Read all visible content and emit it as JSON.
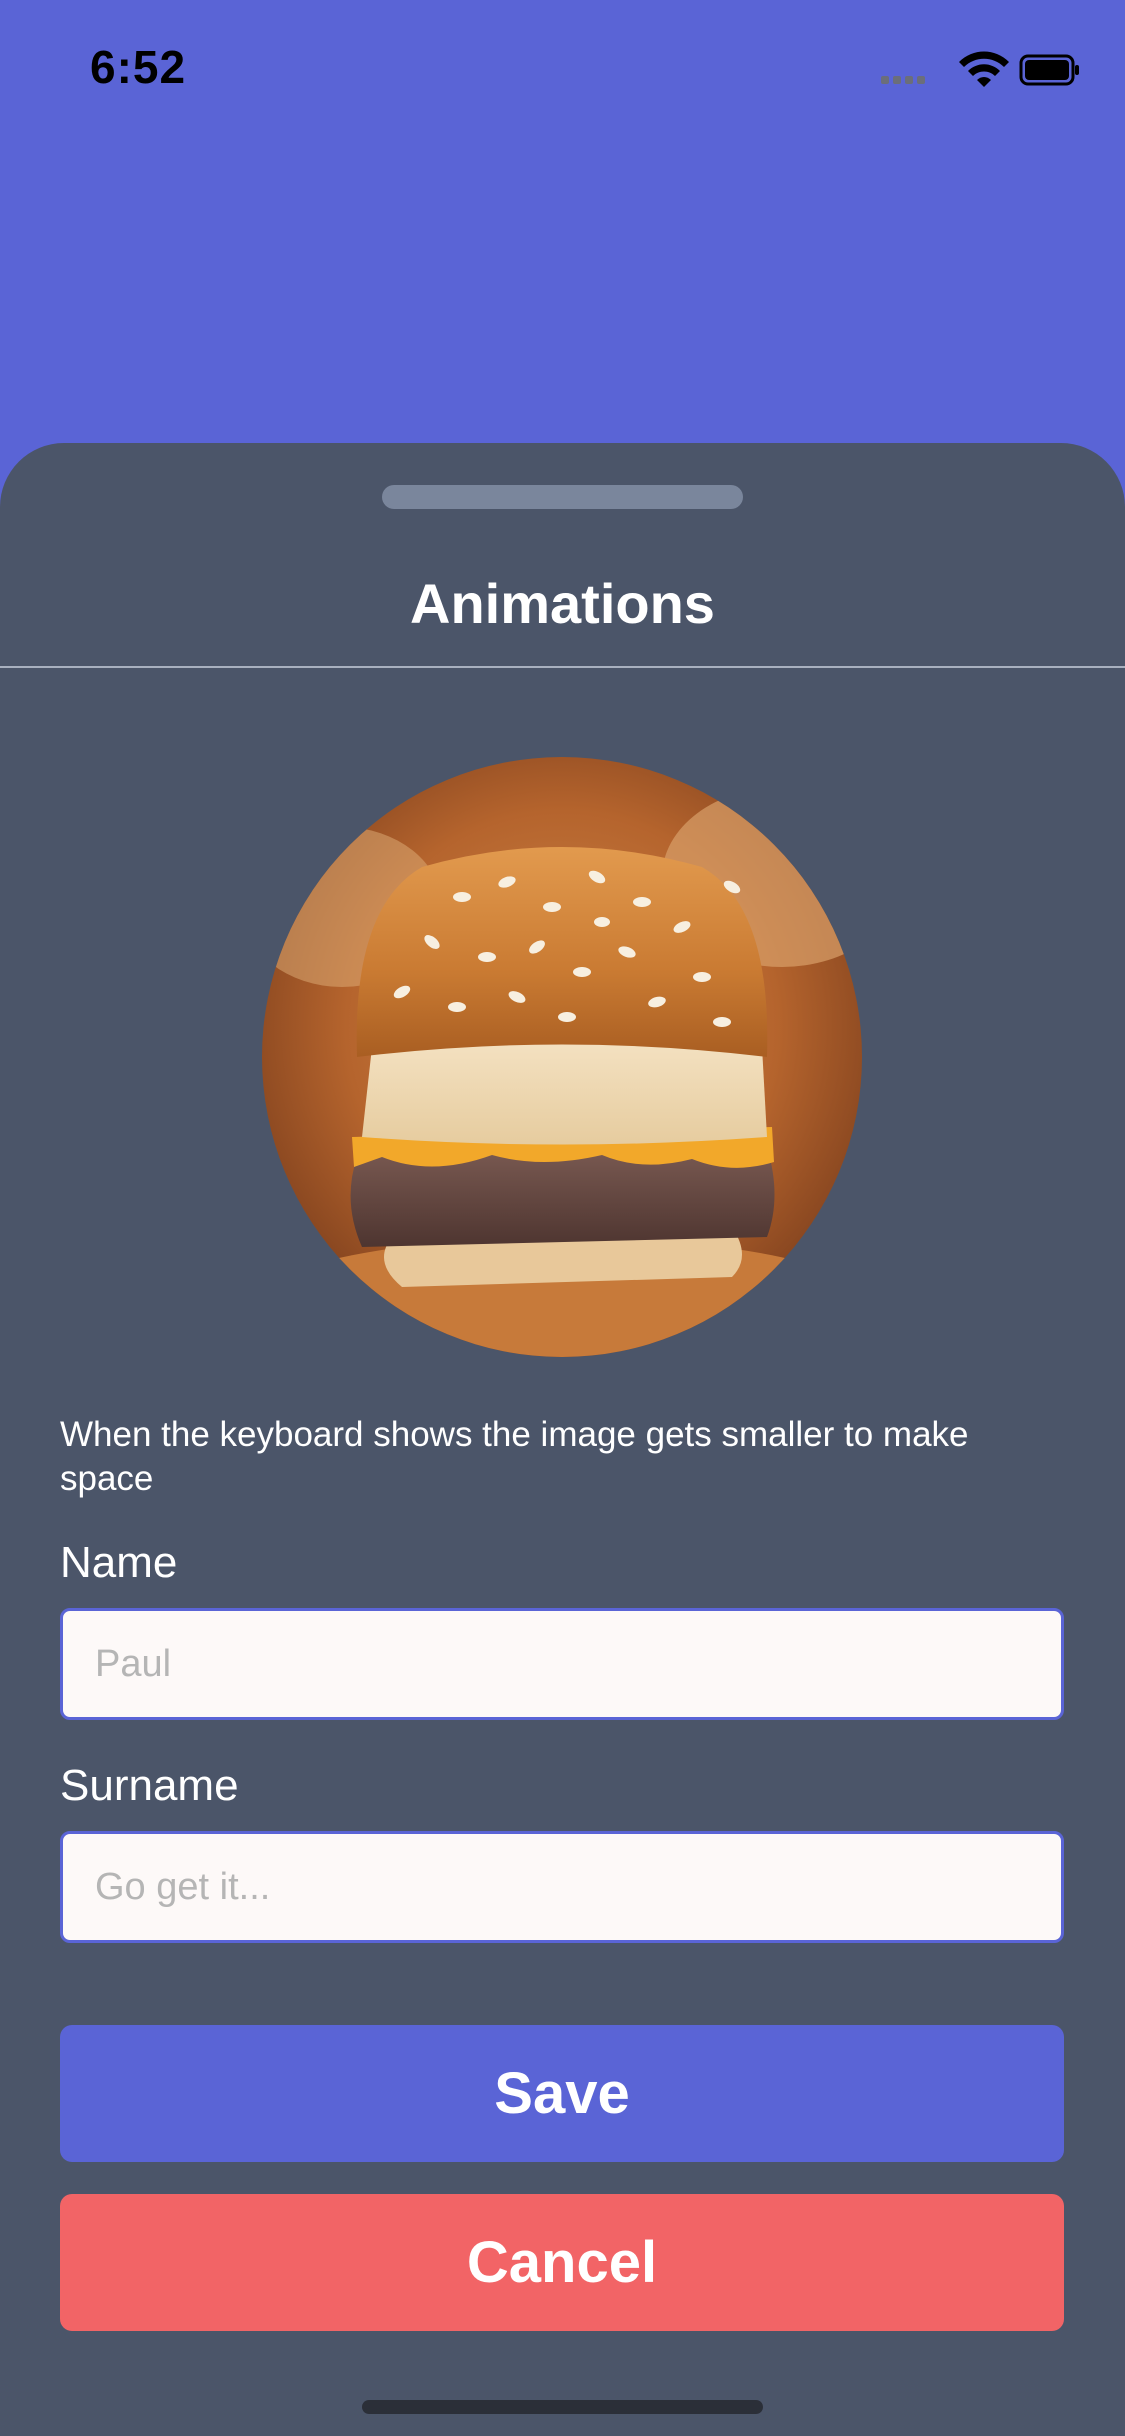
{
  "status_bar": {
    "time": "6:52",
    "icons": [
      "cellular-signal-icon",
      "wifi-icon",
      "battery-icon"
    ]
  },
  "sheet": {
    "title": "Animations",
    "image_subject": "burger-photo",
    "caption": "When the keyboard shows the image gets smaller to make space",
    "form": {
      "name_label": "Name",
      "name_placeholder": "Paul",
      "surname_label": "Surname",
      "surname_placeholder": "Go get it..."
    },
    "buttons": {
      "save_label": "Save",
      "cancel_label": "Cancel"
    }
  },
  "colors": {
    "header_background": "#5a64d6",
    "sheet_background": "#4b5569",
    "save_button": "#5a64d6",
    "cancel_button": "#f26466",
    "input_border": "#5a64d6",
    "input_background": "#fdf9f8"
  }
}
